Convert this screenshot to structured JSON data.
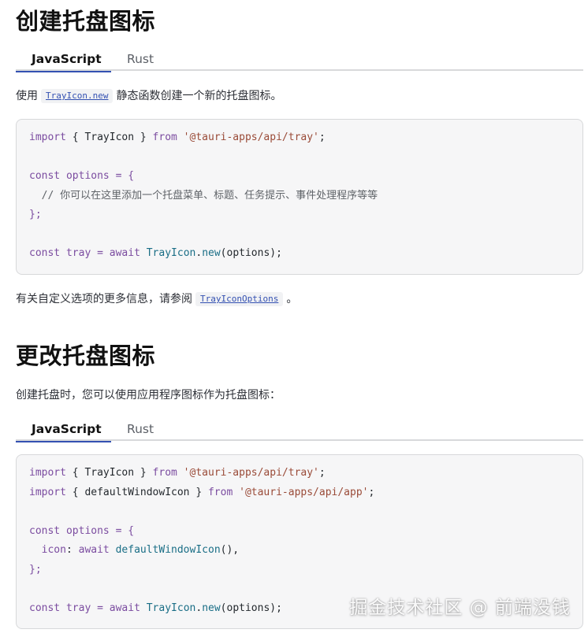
{
  "section1": {
    "title": "创建托盘图标",
    "tabs": [
      {
        "label": "JavaScript",
        "active": true
      },
      {
        "label": "Rust",
        "active": false
      }
    ],
    "intro_prefix": "使用",
    "intro_link": "TrayIcon.new",
    "intro_suffix": "静态函数创建一个新的托盘图标。",
    "code": {
      "line1": {
        "kw1": "import",
        "p1": " { TrayIcon } ",
        "kw2": "from",
        "str": " '@tauri-apps/api/tray'",
        "p2": ";"
      },
      "line3": {
        "kw": "const",
        "var": " options",
        "p": " = {"
      },
      "line4": {
        "cmt": "  // 你可以在这里添加一个托盘菜单、标题、任务提示、事件处理程序等等"
      },
      "line5": {
        "p": "};"
      },
      "line7": {
        "kw": "const",
        "var": " tray",
        "op": " = ",
        "kw2": "await",
        "cls": " TrayIcon",
        "p1": ".",
        "fn": "new",
        "p2": "(options);"
      }
    },
    "outro_prefix": "有关自定义选项的更多信息，请参阅",
    "outro_link": "TrayIconOptions",
    "outro_suffix": "。"
  },
  "section2": {
    "title": "更改托盘图标",
    "intro": "创建托盘时，您可以使用应用程序图标作为托盘图标：",
    "tabs": [
      {
        "label": "JavaScript",
        "active": true
      },
      {
        "label": "Rust",
        "active": false
      }
    ],
    "code": {
      "line1": {
        "kw1": "import",
        "p1": " { TrayIcon } ",
        "kw2": "from",
        "str": " '@tauri-apps/api/tray'",
        "p2": ";"
      },
      "line2": {
        "kw1": "import",
        "p1": " { defaultWindowIcon } ",
        "kw2": "from",
        "str": " '@tauri-apps/api/app'",
        "p2": ";"
      },
      "line4": {
        "kw": "const",
        "var": " options",
        "p": " = {"
      },
      "line5": {
        "key": "  icon",
        "p1": ": ",
        "kw": "await",
        "fn": " defaultWindowIcon",
        "p2": "(),"
      },
      "line6": {
        "p": "};"
      },
      "line8": {
        "kw": "const",
        "var": " tray",
        "op": " = ",
        "kw2": "await",
        "cls": " TrayIcon",
        "p1": ".",
        "fn": "new",
        "p2": "(options);"
      }
    }
  },
  "watermark": "掘金技术社区 @ 前端没钱"
}
